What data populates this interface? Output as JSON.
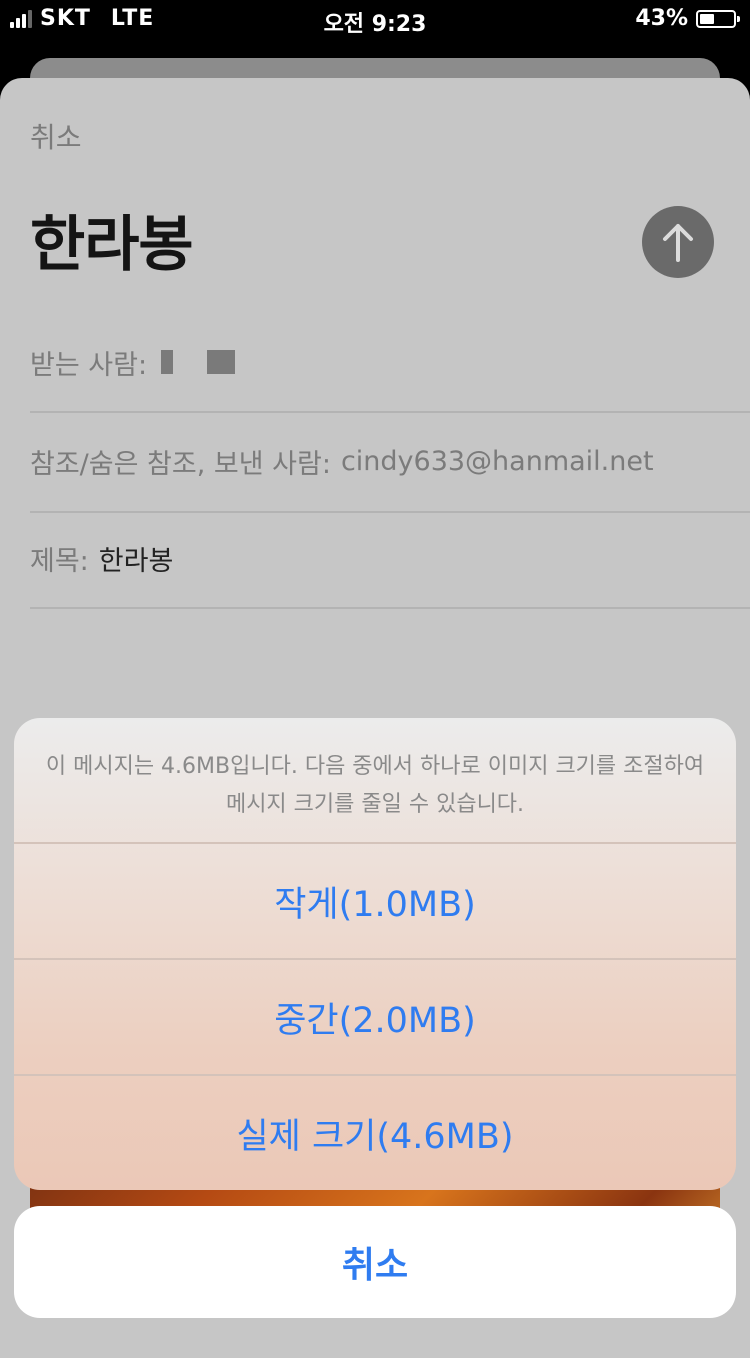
{
  "status_bar": {
    "carrier": "SKT",
    "network": "LTE",
    "time": "오전 9:23",
    "battery_percent": "43%",
    "battery_level": 0.43
  },
  "compose": {
    "cancel_label": "취소",
    "title": "한라봉",
    "send_icon": "arrow-up-icon",
    "to_label": "받는 사람:",
    "cc_label": "참조/숨은 참조, 보낸 사람:",
    "cc_value": "cindy633@hanmail.net",
    "subject_label": "제목:",
    "subject_value": "한라봉"
  },
  "action_sheet": {
    "message": "이 메시지는 4.6MB입니다. 다음 중에서 하나로 이미지 크기를 조절하여 메시지 크기를 줄일 수 있습니다.",
    "options": [
      {
        "label": "작게(1.0MB)"
      },
      {
        "label": "중간(2.0MB)"
      },
      {
        "label": "실제 크기(4.6MB)"
      }
    ],
    "cancel_label": "취소"
  },
  "colors": {
    "accent": "#2f7cf0",
    "overlay": "#c6c6c6"
  }
}
